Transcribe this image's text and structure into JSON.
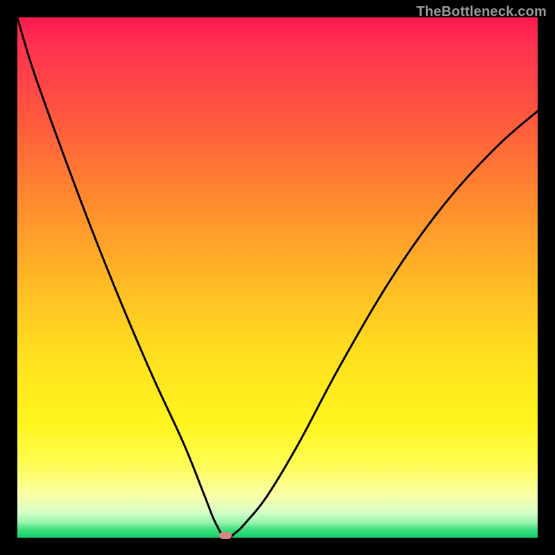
{
  "watermark": "TheBottleneck.com",
  "colors": {
    "frame": "#000000",
    "watermark": "#9a9a9a",
    "curve": "#000000",
    "marker": "#d98383",
    "gradient_top": "#ff1a4f",
    "gradient_mid": "#ffe01f",
    "gradient_bottom": "#15cf72"
  },
  "chart_data": {
    "type": "line",
    "title": "",
    "xlabel": "",
    "ylabel": "",
    "xlim": [
      0,
      100
    ],
    "ylim": [
      0,
      100
    ],
    "note": "No axis ticks or labels are rendered; values are normalized to [0,100] on each axis. The curve is a V-shaped bottleneck profile with its minimum at roughly x≈40, y≈0.",
    "series": [
      {
        "name": "bottleneck-curve",
        "x": [
          0,
          3,
          8,
          14,
          20,
          26,
          32,
          36,
          38,
          40,
          42,
          44,
          48,
          54,
          62,
          72,
          82,
          92,
          100
        ],
        "y": [
          100,
          90,
          76,
          60,
          45,
          31,
          18,
          8,
          3,
          0,
          1,
          3,
          8,
          18,
          33,
          50,
          64,
          75,
          82
        ]
      }
    ],
    "marker": {
      "x": 40,
      "y": 0
    },
    "grid": false,
    "legend": false
  }
}
